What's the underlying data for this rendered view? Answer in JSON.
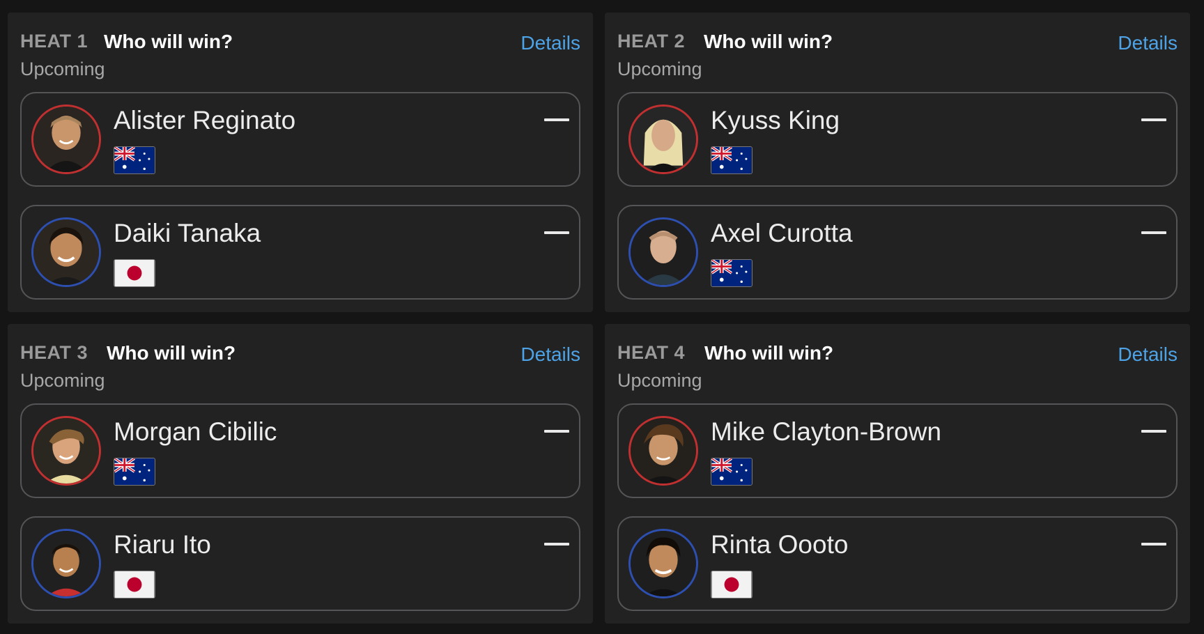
{
  "heats": [
    {
      "label": "HEAT 1",
      "question": "Who will win?",
      "details_label": "Details",
      "status": "Upcoming",
      "surfers": [
        {
          "name": "Alister Reginato",
          "flag": "australia-flag",
          "ring_color": "#c13030",
          "prediction": "—"
        },
        {
          "name": "Daiki Tanaka",
          "flag": "japan-flag",
          "ring_color": "#2d4fb0",
          "prediction": "—"
        }
      ]
    },
    {
      "label": "HEAT 2",
      "question": "Who will win?",
      "details_label": "Details",
      "status": "Upcoming",
      "surfers": [
        {
          "name": "Kyuss King",
          "flag": "australia-flag",
          "ring_color": "#c13030",
          "prediction": "—"
        },
        {
          "name": "Axel Curotta",
          "flag": "australia-flag",
          "ring_color": "#2d4fb0",
          "prediction": "—"
        }
      ]
    },
    {
      "label": "HEAT 3",
      "question": "Who will win?",
      "details_label": "Details",
      "status": "Upcoming",
      "surfers": [
        {
          "name": "Morgan Cibilic",
          "flag": "australia-flag",
          "ring_color": "#c13030",
          "prediction": "—"
        },
        {
          "name": "Riaru Ito",
          "flag": "japan-flag",
          "ring_color": "#2d4fb0",
          "prediction": "—"
        }
      ]
    },
    {
      "label": "HEAT 4",
      "question": "Who will win?",
      "details_label": "Details",
      "status": "Upcoming",
      "surfers": [
        {
          "name": "Mike Clayton-Brown",
          "flag": "australia-flag",
          "ring_color": "#c13030",
          "prediction": "—"
        },
        {
          "name": "Rinta Oooto",
          "flag": "japan-flag",
          "ring_color": "#2d4fb0",
          "prediction": "—"
        }
      ]
    }
  ],
  "colors": {
    "background": "#151515",
    "panel": "#222223",
    "accent_link": "#4da3e6",
    "ring_red": "#c13030",
    "ring_blue": "#2d4fb0"
  }
}
